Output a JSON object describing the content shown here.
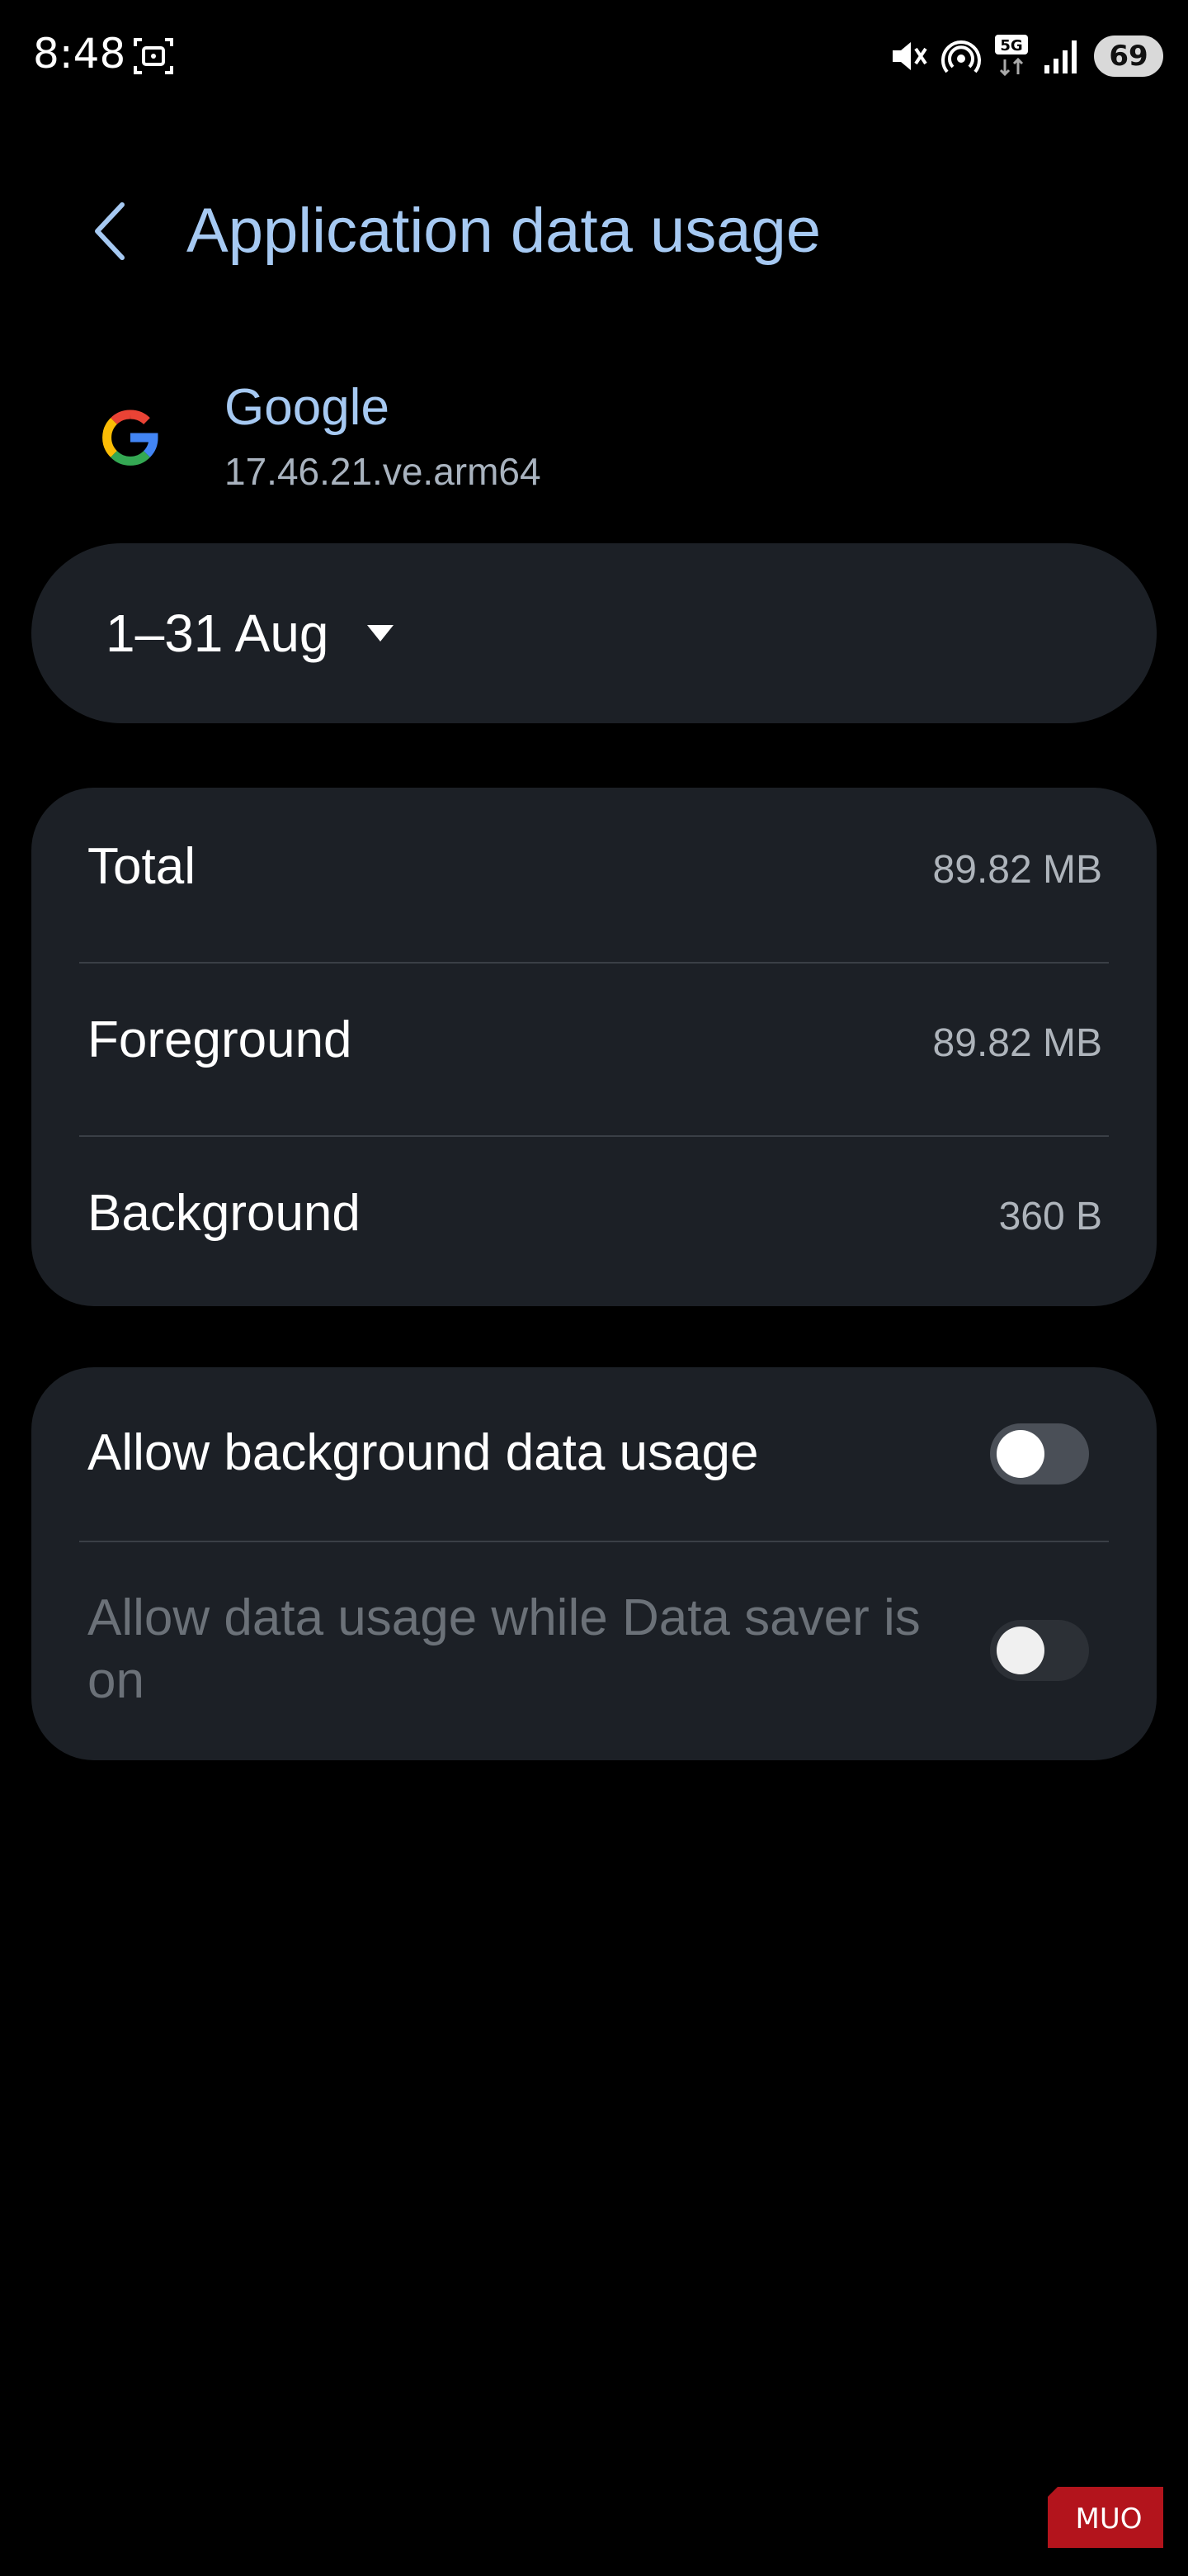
{
  "status_bar": {
    "time": "8:48",
    "battery": "69",
    "icons": [
      "screenshot-icon",
      "mute-vibrate-icon",
      "hotspot-icon",
      "5g-icon",
      "signal-icon",
      "battery-icon"
    ]
  },
  "header": {
    "title": "Application data usage",
    "back_icon": "chevron-left-icon"
  },
  "app": {
    "name": "Google",
    "version": "17.46.21.ve.arm64",
    "icon": "google-g-icon"
  },
  "date_range": {
    "label": "1–31 Aug",
    "icon": "dropdown-triangle-icon"
  },
  "usage": {
    "rows": [
      {
        "label": "Total",
        "value": "89.82 MB"
      },
      {
        "label": "Foreground",
        "value": "89.82 MB"
      },
      {
        "label": "Background",
        "value": "360 B"
      }
    ]
  },
  "settings": {
    "background_data": {
      "label": "Allow background data usage",
      "enabled": false
    },
    "data_saver": {
      "label": "Allow data usage while Data saver is on",
      "enabled": false,
      "disabled": true
    }
  },
  "watermark": {
    "text": "MUO"
  },
  "colors": {
    "background": "#000000",
    "card": "#1c2026",
    "accent": "#a6c9f2",
    "secondary_text": "#aeb4bb",
    "disabled_text": "#6b7178"
  }
}
